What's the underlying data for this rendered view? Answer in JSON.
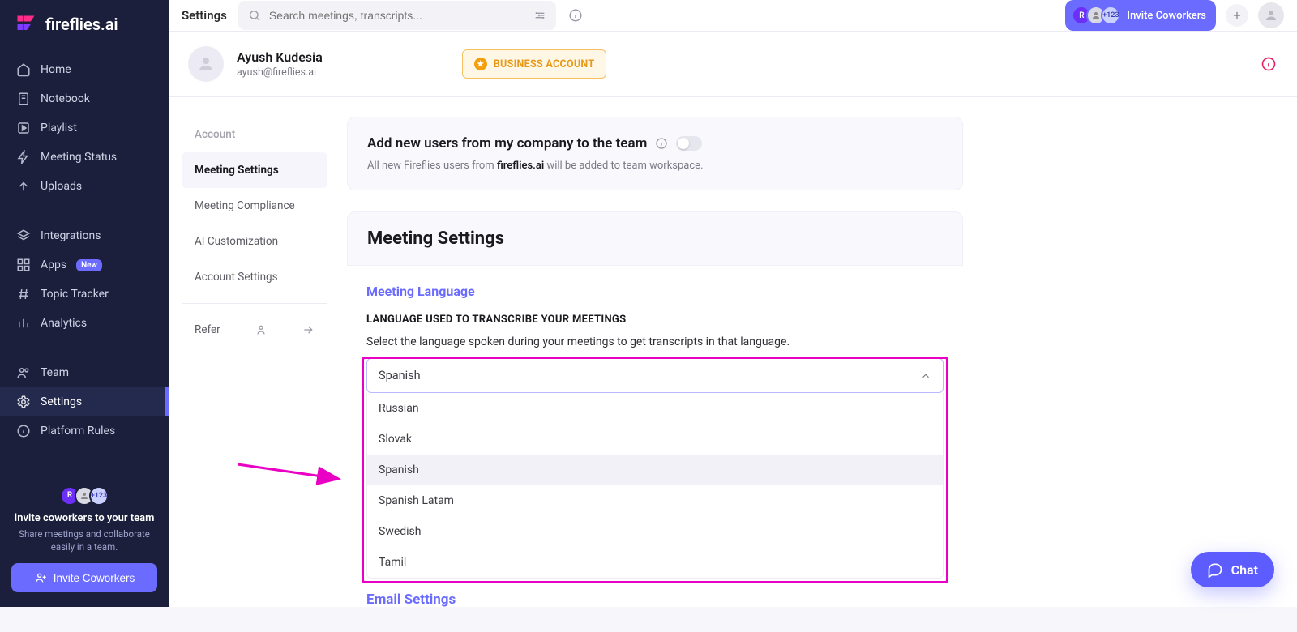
{
  "brand": {
    "name": "fireflies.ai"
  },
  "topbar": {
    "page": "Settings",
    "search_placeholder": "Search meetings, transcripts...",
    "invite_label": "Invite Coworkers",
    "avatar_badge": "+123"
  },
  "sidebar": {
    "items1": [
      {
        "label": "Home"
      },
      {
        "label": "Notebook"
      },
      {
        "label": "Playlist"
      },
      {
        "label": "Meeting Status"
      },
      {
        "label": "Uploads"
      }
    ],
    "items2": [
      {
        "label": "Integrations"
      },
      {
        "label": "Apps",
        "badge": "New"
      },
      {
        "label": "Topic Tracker"
      },
      {
        "label": "Analytics"
      }
    ],
    "items3": [
      {
        "label": "Team"
      },
      {
        "label": "Settings",
        "active": true
      },
      {
        "label": "Platform Rules"
      }
    ],
    "invite": {
      "title": "Invite coworkers to your team",
      "subtitle": "Share meetings and collaborate easily in a team.",
      "button": "Invite Coworkers",
      "avatar_badge": "+123"
    }
  },
  "profile": {
    "name": "Ayush Kudesia",
    "email": "ayush@fireflies.ai",
    "badge": "BUSINESS ACCOUNT"
  },
  "settings_nav": {
    "items": [
      {
        "label": "Account",
        "muted": true
      },
      {
        "label": "Meeting Settings",
        "active": true
      },
      {
        "label": "Meeting Compliance"
      },
      {
        "label": "AI Customization"
      },
      {
        "label": "Account Settings"
      }
    ],
    "refer": "Refer"
  },
  "add_users": {
    "title": "Add new users from my company to the team",
    "subtitle_pre": "All new Fireflies users from ",
    "subtitle_bold": "fireflies.ai",
    "subtitle_post": " will be added to team workspace."
  },
  "meeting_settings": {
    "heading": "Meeting Settings",
    "lang_title": "Meeting Language",
    "lang_upper": "LANGUAGE USED TO TRANSCRIBE YOUR MEETINGS",
    "lang_helper": "Select the language spoken during your meetings to get transcripts in that language.",
    "selected": "Spanish",
    "options": [
      "Russian",
      "Slovak",
      "Spanish",
      "Spanish Latam",
      "Swedish",
      "Tamil"
    ],
    "email_heading": "Email Settings"
  },
  "chat": {
    "label": "Chat"
  }
}
